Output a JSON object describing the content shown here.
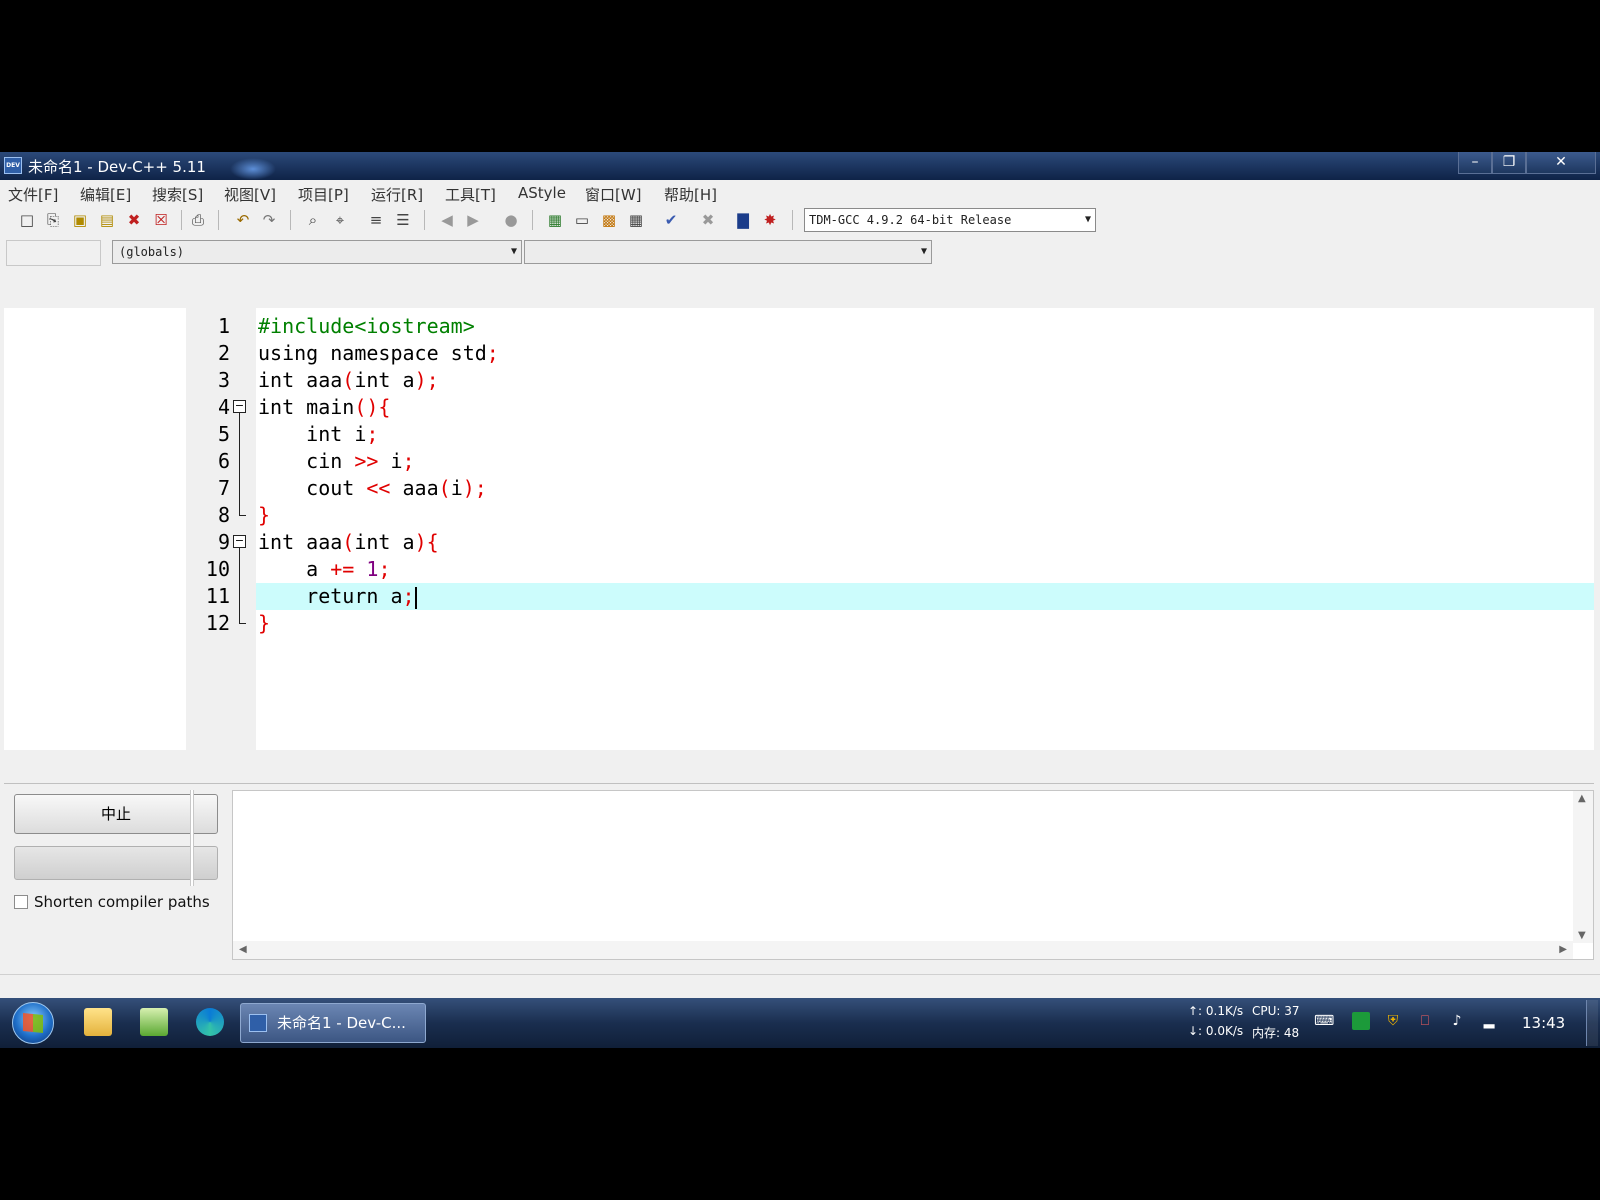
{
  "window": {
    "title": "未命名1 - Dev-C++ 5.11",
    "app_icon_text": "DEV"
  },
  "menu": [
    "文件[F]",
    "编辑[E]",
    "搜索[S]",
    "视图[V]",
    "项目[P]",
    "运行[R]",
    "工具[T]",
    "AStyle",
    "窗口[W]",
    "帮助[H]"
  ],
  "toolbar": {
    "compiler": "TDM-GCC 4.9.2 64-bit Release"
  },
  "classbar": {
    "scope": "(globals)",
    "member": ""
  },
  "editor": {
    "line_numbers": [
      "1",
      "2",
      "3",
      "4",
      "5",
      "6",
      "7",
      "8",
      "9",
      "10",
      "11",
      "12"
    ],
    "lines": [
      {
        "tokens": [
          {
            "t": "#include<iostream>",
            "c": "pp"
          }
        ]
      },
      {
        "tokens": [
          {
            "t": "using namespace std",
            "c": "kw"
          },
          {
            "t": ";",
            "c": "red"
          }
        ]
      },
      {
        "tokens": [
          {
            "t": "int aaa",
            "c": "kw"
          },
          {
            "t": "(",
            "c": "red"
          },
          {
            "t": "int a",
            "c": "kw"
          },
          {
            "t": ");",
            "c": "red"
          }
        ]
      },
      {
        "tokens": [
          {
            "t": "int main",
            "c": "kw"
          },
          {
            "t": "(){",
            "c": "red"
          }
        ]
      },
      {
        "tokens": [
          {
            "t": "    int i",
            "c": "kw"
          },
          {
            "t": ";",
            "c": "red"
          }
        ]
      },
      {
        "tokens": [
          {
            "t": "    cin ",
            "c": "kw"
          },
          {
            "t": ">>",
            "c": "red"
          },
          {
            "t": " i",
            "c": "kw"
          },
          {
            "t": ";",
            "c": "red"
          }
        ]
      },
      {
        "tokens": [
          {
            "t": "    cout ",
            "c": "kw"
          },
          {
            "t": "<<",
            "c": "red"
          },
          {
            "t": " aaa",
            "c": "kw"
          },
          {
            "t": "(",
            "c": "red"
          },
          {
            "t": "i",
            "c": "kw"
          },
          {
            "t": ");",
            "c": "red"
          }
        ]
      },
      {
        "tokens": [
          {
            "t": "}",
            "c": "red"
          }
        ]
      },
      {
        "tokens": [
          {
            "t": "int aaa",
            "c": "kw"
          },
          {
            "t": "(",
            "c": "red"
          },
          {
            "t": "int a",
            "c": "kw"
          },
          {
            "t": "){",
            "c": "red"
          }
        ]
      },
      {
        "tokens": [
          {
            "t": "    a ",
            "c": "kw"
          },
          {
            "t": "+=",
            "c": "red"
          },
          {
            "t": " ",
            "c": "kw"
          },
          {
            "t": "1",
            "c": "num"
          },
          {
            "t": ";",
            "c": "red"
          }
        ]
      },
      {
        "tokens": [
          {
            "t": "    return a",
            "c": "kw"
          },
          {
            "t": ";",
            "c": "red"
          }
        ]
      },
      {
        "tokens": [
          {
            "t": "}",
            "c": "red"
          }
        ]
      }
    ],
    "active_line": 11
  },
  "compile_panel": {
    "stop_label": "中止",
    "progress": 0,
    "shorten_paths_label": "Shorten compiler paths",
    "shorten_paths_checked": false
  },
  "taskbar": {
    "task_label": "未命名1 - Dev-C...",
    "net_up": "↑: 0.1K/s",
    "net_down": "↓: 0.0K/s",
    "cpu": "CPU: 37",
    "mem": "内存: 48",
    "clock": "13:43"
  },
  "colors": {
    "keyword": "#000000",
    "preprocessor": "#008000",
    "operator": "#e00000",
    "number": "#800080",
    "active_line": "#ccfcfc"
  }
}
